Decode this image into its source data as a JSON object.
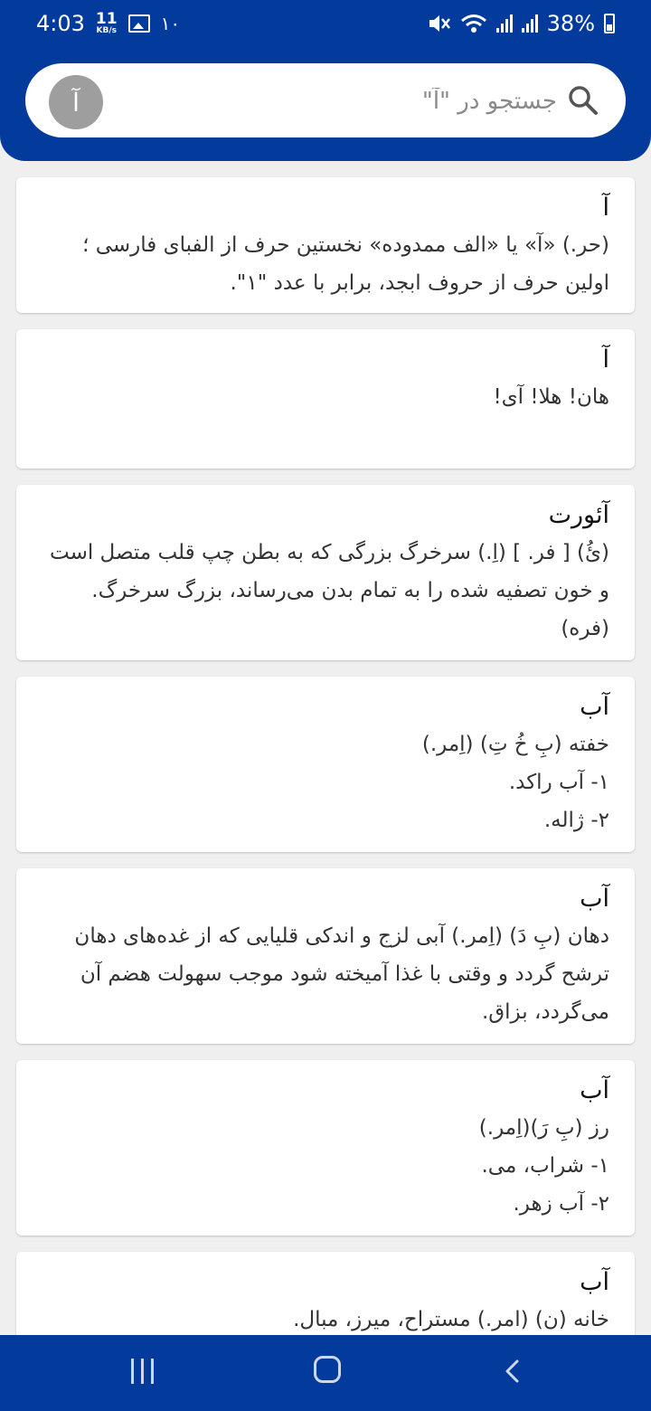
{
  "status_bar": {
    "time": "4:03",
    "net_speed_value": "11",
    "net_speed_unit": "KB/s",
    "notification_count": "۱۰",
    "battery": "38%"
  },
  "search": {
    "avatar_letter": "آ",
    "placeholder": "جستجو در \"آ\""
  },
  "entries": [
    {
      "term": "آ",
      "lines": [
        "(حر.) «آ» یا «الف ممدوده» نخستین حرف از الفبای فارسی ؛ اولین حرف از حروف ابجد، برابر با عدد \"۱\"."
      ]
    },
    {
      "term": "آ",
      "lines": [
        "هان! هلا! آی!"
      ]
    },
    {
      "term": "آئورت",
      "lines": [
        "(ئُ) [ فر. ] (اِ.) سرخرگ بزرگی که به بطن چپ قلب متصل است و خون تصفیه شده را به تمام بدن می‌رساند، بزرگ سرخرگ.  (فره)"
      ]
    },
    {
      "term": "آب",
      "lines": [
        "خفته  (بِ خُ تِ) (اِمر.)",
        "۱- آب راکد.",
        "۲-  ژاله."
      ]
    },
    {
      "term": "آب",
      "lines": [
        "دهان  (بِ دَ) (اِمر.) آبی لزج و اندکی قلیایی که از غده‌های دهان ترشح گردد و وقتی با غذا آمیخته شود موجب سهولت هضم آن می‌گردد، بزاق."
      ]
    },
    {
      "term": "آب",
      "lines": [
        "رز (بِ رَ)(اِمر.)",
        "۱- شراب، می.",
        "۲- آب زهر."
      ]
    },
    {
      "term": "آب",
      "lines": [
        "خانه  (ن) (امر.) مستراح، میرز، مبال."
      ]
    }
  ],
  "colors": {
    "header_bg": "#033b9c",
    "background": "#efefef",
    "card_bg": "#ffffff",
    "avatar_bg": "#9e9e9e"
  },
  "icons": {
    "search": "search-icon",
    "gallery": "gallery-icon",
    "wifi": "wifi-icon",
    "signal": "signal-icon",
    "battery": "battery-icon",
    "mute": "mute-icon",
    "recent_apps": "recent-apps-icon",
    "home": "home-icon",
    "back": "back-icon"
  }
}
